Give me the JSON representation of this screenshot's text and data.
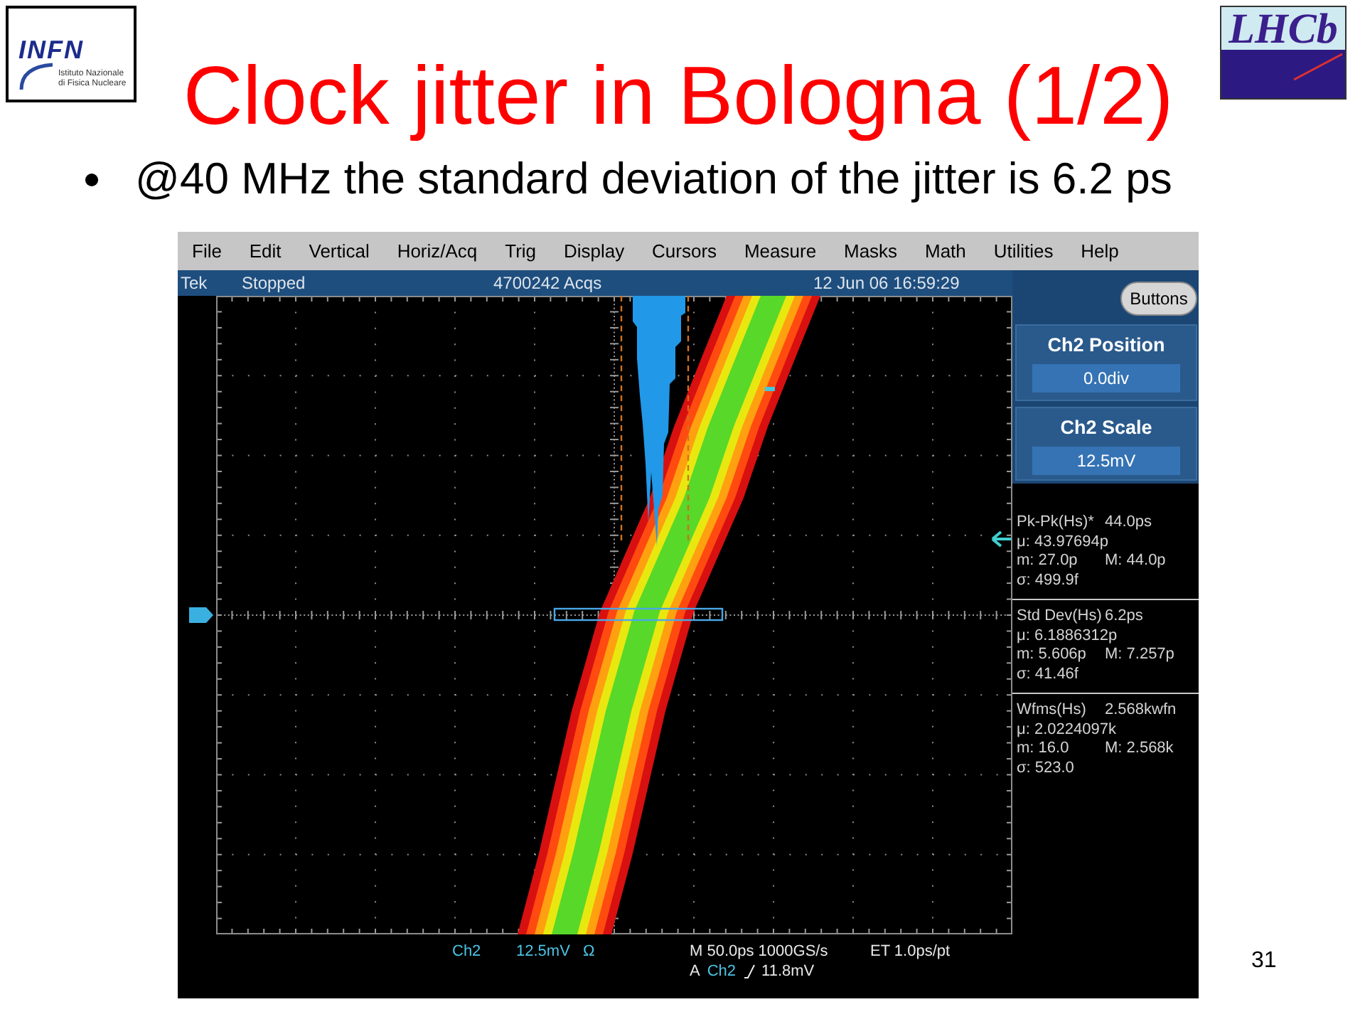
{
  "slide": {
    "title": "Clock jitter in Bologna (1/2)",
    "bullets": [
      "@40 MHz the standard deviation of the jitter is 6.2 ps"
    ],
    "page_number": "31"
  },
  "logos": {
    "left": {
      "wordmark": "INFN",
      "subtitle_lines": [
        "Istituto Nazionale",
        "di Fisica Nucleare"
      ]
    },
    "right": {
      "wordmark": "LHCb"
    }
  },
  "scope": {
    "menu": [
      "File",
      "Edit",
      "Vertical",
      "Horiz/Acq",
      "Trig",
      "Display",
      "Cursors",
      "Measure",
      "Masks",
      "Math",
      "Utilities",
      "Help"
    ],
    "status_bar": {
      "brand": "Tek",
      "state": "Stopped",
      "acquisitions": "4700242 Acqs",
      "timestamp": "12 Jun 06 16:59:29"
    },
    "side_panel": {
      "button": "Buttons",
      "controls": [
        {
          "title": "Ch2 Position",
          "value": "0.0div"
        },
        {
          "title": "Ch2 Scale",
          "value": "12.5mV"
        }
      ],
      "measurements": [
        {
          "name": "Pk-Pk(Hs)*",
          "value": "44.0ps",
          "mean": "μ: 43.97694p",
          "min": "m: 27.0p",
          "max": "M: 44.0p",
          "std": "σ: 499.9f"
        },
        {
          "name": "Std Dev(Hs)",
          "value": "6.2ps",
          "mean": "μ: 6.1886312p",
          "min": "m: 5.606p",
          "max": "M: 7.257p",
          "std": "σ: 41.46f"
        },
        {
          "name": "Wfms(Hs)",
          "value": "2.568kwfn",
          "mean": "μ: 2.0224097k",
          "min": "m: 16.0",
          "max": "M: 2.568k",
          "std": "σ: 523.0"
        }
      ]
    },
    "readouts": {
      "channel": "Ch2",
      "scale": "12.5mV",
      "termination": "Ω",
      "timebase": "M 50.0ps 1000GS/s",
      "sample_interval": "ET 1.0ps/pt",
      "trigger": {
        "mode": "A",
        "source": "Ch2",
        "threshold": "11.8mV"
      }
    }
  }
}
